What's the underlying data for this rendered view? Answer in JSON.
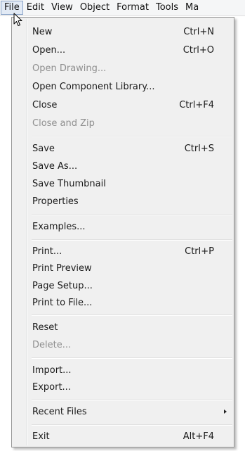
{
  "menubar": {
    "items": [
      "File",
      "Edit",
      "View",
      "Object",
      "Format",
      "Tools",
      "Ma"
    ]
  },
  "file_menu": {
    "new": {
      "label": "New",
      "shortcut": "Ctrl+N"
    },
    "open": {
      "label": "Open...",
      "shortcut": "Ctrl+O"
    },
    "open_drawing": {
      "label": "Open Drawing...",
      "disabled": true
    },
    "open_component_library": {
      "label": "Open Component Library..."
    },
    "close": {
      "label": "Close",
      "shortcut": "Ctrl+F4"
    },
    "close_and_zip": {
      "label": "Close and Zip",
      "disabled": true
    },
    "save": {
      "label": "Save",
      "shortcut": "Ctrl+S"
    },
    "save_as": {
      "label": "Save As..."
    },
    "save_thumbnail": {
      "label": "Save Thumbnail"
    },
    "properties": {
      "label": "Properties"
    },
    "examples": {
      "label": "Examples..."
    },
    "print": {
      "label": "Print...",
      "shortcut": "Ctrl+P"
    },
    "print_preview": {
      "label": "Print Preview"
    },
    "page_setup": {
      "label": "Page Setup..."
    },
    "print_to_file": {
      "label": "Print to File..."
    },
    "reset": {
      "label": "Reset"
    },
    "delete": {
      "label": "Delete...",
      "disabled": true
    },
    "import": {
      "label": "Import..."
    },
    "export": {
      "label": "Export..."
    },
    "recent_files": {
      "label": "Recent Files",
      "has_submenu": true
    },
    "exit": {
      "label": "Exit",
      "shortcut": "Alt+F4"
    }
  }
}
